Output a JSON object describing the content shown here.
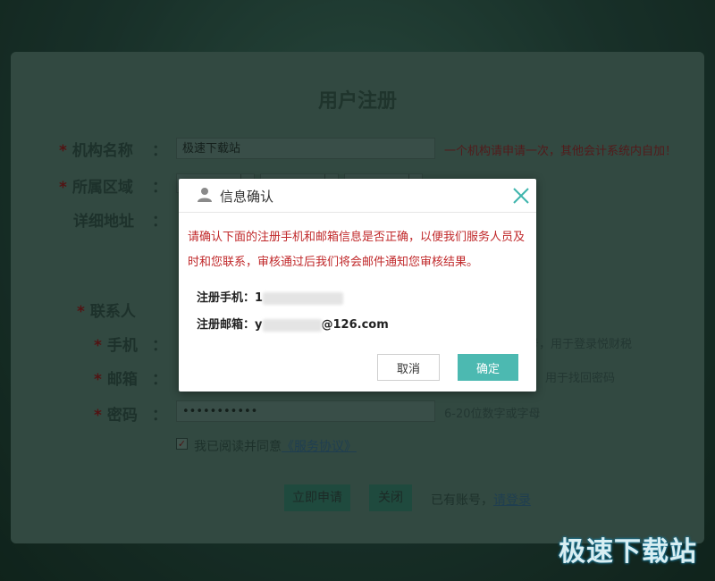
{
  "form": {
    "title": "用户注册",
    "org_name": {
      "label": "机构名称",
      "value": "极速下载站",
      "hint": "一个机构请申请一次，其他会计系统内自加！"
    },
    "region": {
      "label": "所属区域"
    },
    "address": {
      "label": "详细地址"
    },
    "contact": {
      "label": "联系人"
    },
    "phone": {
      "label": "手机",
      "hint": "号，用于登录悦财税"
    },
    "email": {
      "label": "邮箱",
      "hint": "用于找回密码"
    },
    "password": {
      "label": "密码",
      "value": "•••••••••••",
      "hint": "6-20位数字或字母"
    },
    "agree": {
      "text": "我已阅读并同意",
      "link": "《服务协议》",
      "check": "✓"
    },
    "submit_label": "立即申请",
    "close_label": "关闭",
    "login_prompt": "已有账号，",
    "login_link": "请登录",
    "colon": "："
  },
  "dialog": {
    "title": "信息确认",
    "message": "请确认下面的注册手机和邮箱信息是否正确，以便我们服务人员及时和您联系，审核通过后我们将会邮件通知您审核结果。",
    "phone_label": "注册手机：",
    "phone_prefix": "1",
    "email_label": "注册邮箱：",
    "email_prefix": "y",
    "email_suffix": "@126.com",
    "cancel_label": "取消",
    "ok_label": "确定",
    "accent_color": "#4cb9b1",
    "message_color": "#c0282a"
  },
  "watermark": "极速下载站"
}
